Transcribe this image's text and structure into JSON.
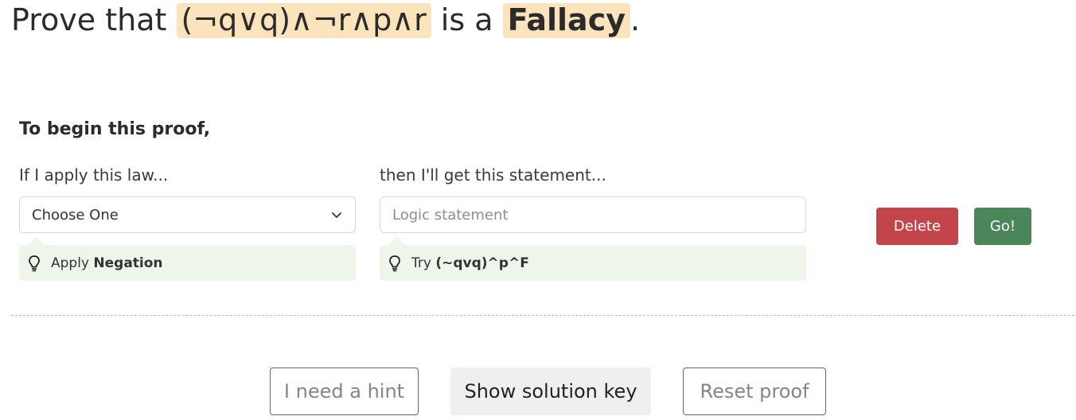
{
  "title": {
    "prefix": "Prove that",
    "expression": "(¬q∨q)∧¬r∧p∧r",
    "middle": "is a",
    "goal": "Fallacy",
    "suffix": "."
  },
  "step": {
    "intro": "To begin this proof,",
    "law_label": "If I apply this law...",
    "statement_label": "then I'll get this statement...",
    "law_select": {
      "value": "Choose One",
      "icon": "chevron-down-icon"
    },
    "statement_input": {
      "value": "",
      "placeholder": "Logic statement"
    },
    "law_hint": {
      "icon": "lightbulb-icon",
      "prefix": "Apply",
      "value": "Negation"
    },
    "statement_hint": {
      "icon": "lightbulb-icon",
      "prefix": "Try",
      "value": "(~qvq)^p^F"
    },
    "delete_label": "Delete",
    "go_label": "Go!"
  },
  "controls": {
    "hint_label": "I need a hint",
    "solution_label": "Show solution key",
    "reset_label": "Reset proof"
  },
  "colors": {
    "highlight": "#fbe3bb",
    "hint_background": "#eef6ec",
    "delete": "#c3454a",
    "go": "#4b865b"
  }
}
